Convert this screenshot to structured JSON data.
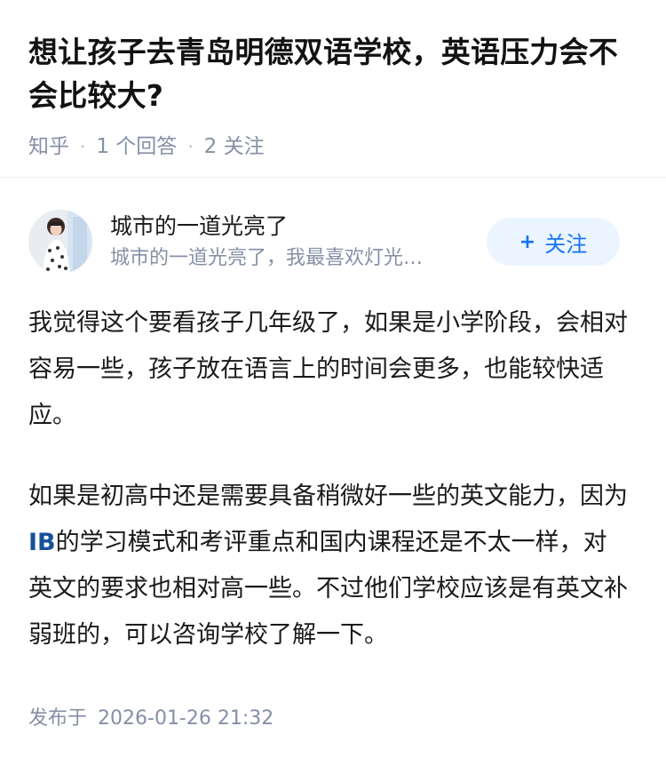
{
  "question": {
    "title": "想让孩子去青岛明德双语学校，英语压力会不会比较大?",
    "source": "知乎",
    "answers_count": "1 个回答",
    "followers_count": "2 关注"
  },
  "author": {
    "name": "城市的一道光亮了",
    "bio": "城市的一道光亮了，我最喜欢灯光…",
    "follow_label": "关注",
    "follow_icon": "plus-icon"
  },
  "answer": {
    "paragraph_1": "我觉得这个要看孩子几年级了，如果是小学阶段，会相对容易一些，孩子放在语言上的时间会更多，也能较快适应。",
    "paragraph_2_before": "如果是初高中还是需要具备稍微好一些的英文能力，因为",
    "paragraph_2_link": "IB",
    "paragraph_2_after": "的学习模式和考评重点和国内课程还是不太一样，对英文的要求也相对高一些。不过他们学校应该是有英文补弱班的，可以咨询学校了解一下。"
  },
  "footer": {
    "published_label": "发布于",
    "published_time": "2026-01-26 21:32"
  },
  "colors": {
    "accent": "#1772f6",
    "follow_bg": "#ebf5ff",
    "meta_text": "#8590a6",
    "keyword_link": "#175199",
    "body_text": "#1a1a1a"
  }
}
